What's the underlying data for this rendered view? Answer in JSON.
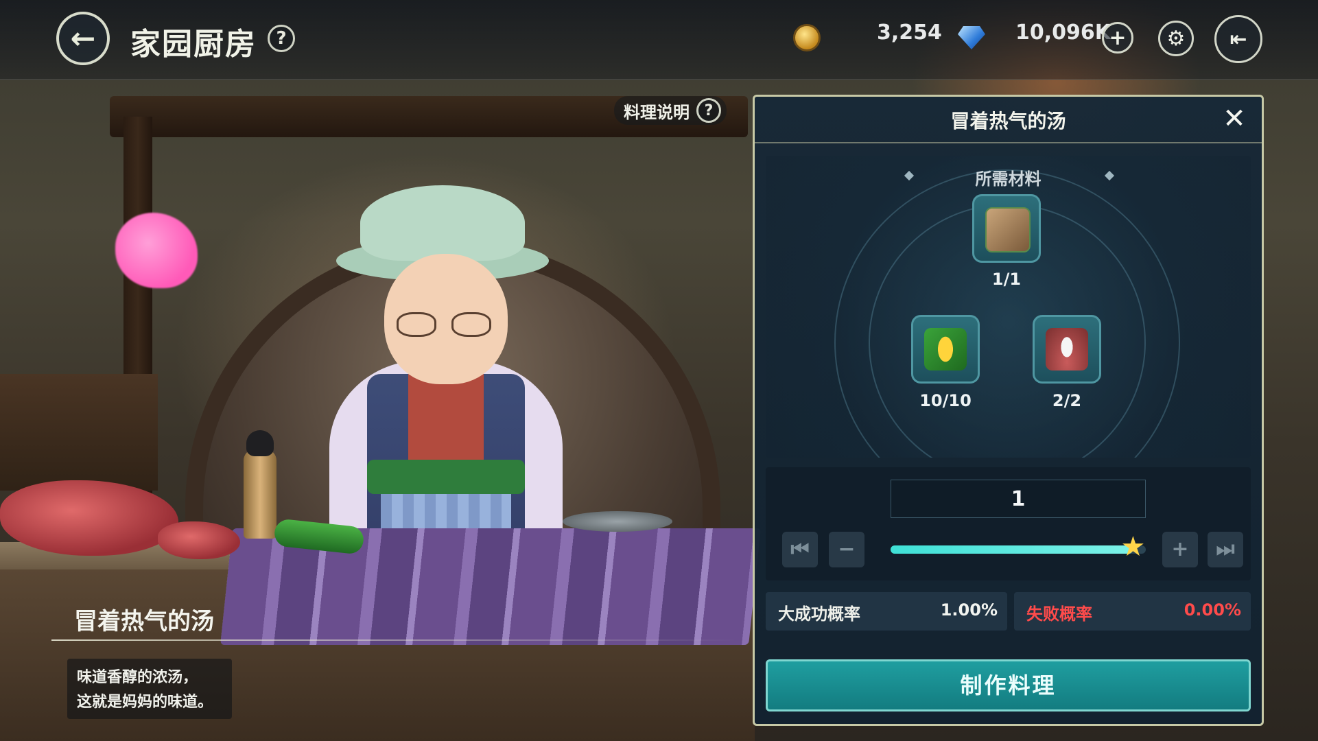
{
  "header": {
    "back_icon": "back-arrow-icon",
    "title": "家园厨房",
    "help": "?"
  },
  "currencies": {
    "gold": {
      "icon": "gold-coin-icon",
      "value": "3,254"
    },
    "gem": {
      "icon": "blue-gem-icon",
      "value": "10,096K",
      "add": "+"
    }
  },
  "topbar_icons": {
    "settings": "settings-gear-icon",
    "exit": "exit-door-icon"
  },
  "recipe_help": {
    "label": "料理说明",
    "help": "?"
  },
  "dish": {
    "name": "冒着热气的汤",
    "description": "味道香醇的浓汤，\n这就是妈妈的味道。"
  },
  "panel": {
    "title": "冒着热气的汤",
    "close": "✕",
    "materials_label": "所需材料",
    "materials": [
      {
        "name": "ingredient-herb-board",
        "icon": "herb-board-icon",
        "count": "1/1"
      },
      {
        "name": "ingredient-corn",
        "icon": "corn-icon",
        "count": "10/10"
      },
      {
        "name": "ingredient-milk",
        "icon": "milk-bottle-icon",
        "count": "2/2"
      }
    ],
    "quantity": "1",
    "slider": {
      "first": "⏮",
      "minus": "−",
      "plus": "+",
      "last": "⏭",
      "fill_fraction": 0.95,
      "handle_icon": "star-icon"
    },
    "great_success": {
      "label": "大成功概率",
      "value": "1.00%",
      "color": "#f2f4f0"
    },
    "failure": {
      "label": "失败概率",
      "value": "0.00%",
      "color": "#ff4b4b"
    },
    "make_button": "制作料理"
  },
  "colors": {
    "accent": "#1f9ea0",
    "panel_border": "#c7c9a6",
    "slider_fill": "#3fe0d6"
  }
}
